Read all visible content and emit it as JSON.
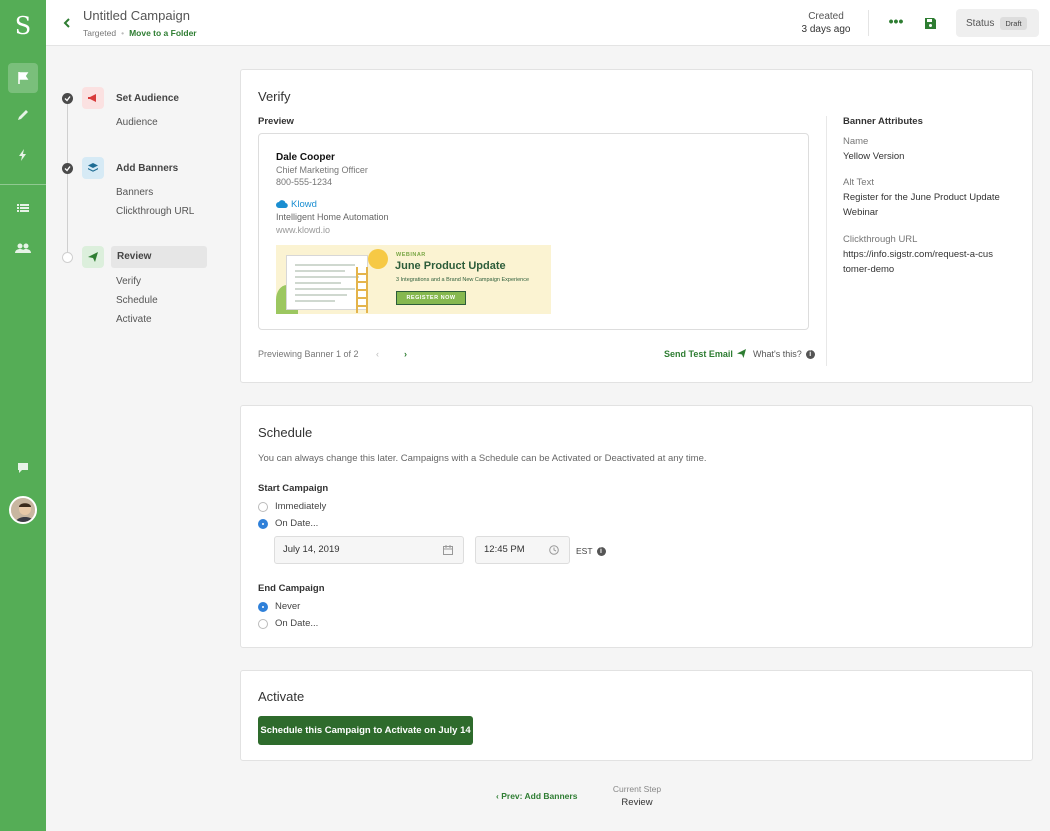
{
  "rail": {
    "logo": "S",
    "nav_icons": [
      "flag-icon",
      "pencil-icon",
      "lightning-icon",
      "list-icon",
      "users-icon",
      "chat-icon"
    ],
    "accent_color": "#55ad56"
  },
  "topbar": {
    "title": "Untitled Campaign",
    "campaign_type": "Targeted",
    "move_folder": "Move to a Folder",
    "created_label": "Created",
    "created_value": "3 days ago",
    "status_label": "Status",
    "status_value": "Draft"
  },
  "steps": [
    {
      "title": "Set Audience",
      "state": "done",
      "subs": [
        "Audience"
      ]
    },
    {
      "title": "Add Banners",
      "state": "done",
      "subs": [
        "Banners",
        "Clickthrough URL"
      ]
    },
    {
      "title": "Review",
      "state": "current",
      "subs": [
        "Verify",
        "Schedule",
        "Activate"
      ]
    }
  ],
  "verify": {
    "title": "Verify",
    "preview_label": "Preview",
    "signature": {
      "name": "Dale Cooper",
      "role": "Chief Marketing Officer",
      "phone": "800-555-1234",
      "brand": "Klowd",
      "tagline": "Intelligent Home Automation",
      "website": "www.klowd.io"
    },
    "banner": {
      "kicker": "WEBINAR",
      "title": "June Product Update",
      "subtitle": "3 Integrations and a Brand New Campaign Experience",
      "cta": "REGISTER NOW"
    },
    "previewing": "Previewing Banner 1 of 2",
    "send_test": "Send Test Email",
    "whats_this": "What's this?",
    "attributes_title": "Banner Attributes",
    "attributes": [
      {
        "label": "Name",
        "value": "Yellow Version"
      },
      {
        "label": "Alt Text",
        "value": "Register for the June Product Update Webinar"
      },
      {
        "label": "Clickthrough URL",
        "value": "https://info.sigstr.com/request-a-customer-demo"
      }
    ]
  },
  "schedule": {
    "title": "Schedule",
    "description": "You can always change this later. Campaigns with a Schedule can be Activated or Deactivated at any time.",
    "start_label": "Start Campaign",
    "start_options": [
      "Immediately",
      "On Date..."
    ],
    "start_selected": 1,
    "date_value": "July 14, 2019",
    "time_value": "12:45 PM",
    "timezone": "EST",
    "end_label": "End Campaign",
    "end_options": [
      "Never",
      "On Date..."
    ],
    "end_selected": 0
  },
  "activate": {
    "title": "Activate",
    "button": "Schedule this Campaign to Activate on July 14"
  },
  "footer": {
    "prev": "Prev: Add Banners",
    "current_label": "Current Step",
    "current_value": "Review"
  }
}
